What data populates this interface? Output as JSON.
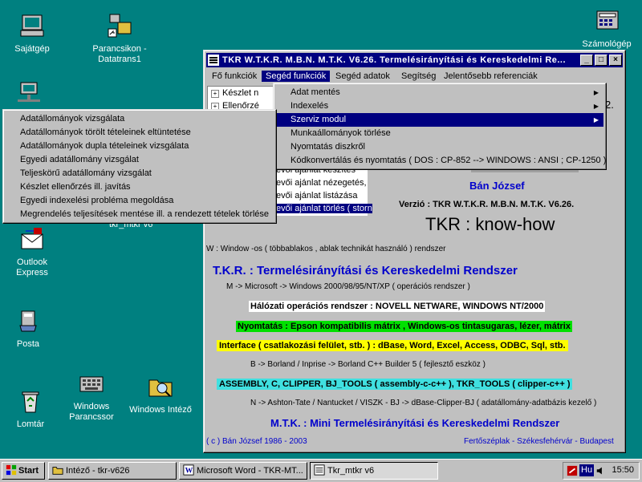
{
  "desktop": {
    "icons": [
      {
        "label": "Sajátgép",
        "name": "my-computer-icon"
      },
      {
        "label": "Parancsikon - Datatrans1",
        "name": "datatrans-shortcut-icon"
      },
      {
        "label": "Számológép",
        "name": "calculator-icon"
      },
      {
        "label": "Outlook Express",
        "name": "outlook-express-icon"
      },
      {
        "label": "Posta",
        "name": "posta-icon"
      },
      {
        "label": "Lomtár",
        "name": "recycle-bin-icon"
      },
      {
        "label": "Windows Parancssor",
        "name": "command-prompt-icon"
      },
      {
        "label": "Windows Intéző",
        "name": "windows-explorer-icon"
      }
    ],
    "partial_label": "tkr_mtkr v6"
  },
  "window": {
    "title": "TKR W.T.K.R. M.B.N. M.T.K. V6.26. Termelésirányítási és Kereskedelmi Re...",
    "minimize": "_",
    "maximize": "□",
    "close": "×",
    "menubar": [
      "Fő funkciók",
      "Segéd funkciók",
      "Segéd adatok",
      "Segítség",
      "Jelentősebb referenciák"
    ],
    "tree_rows": [
      "Készlet n",
      "Ellenőrzé",
      "evői ajánlat készítés",
      "evői ajánlat nézegetés,",
      "evői ajánlat listázása",
      "evői ajánlat törlés ( storn"
    ],
    "right_fragment": "2.",
    "author": "Bán József",
    "version": "Verzió : TKR W.T.K.R. M.B.N. M.T.K. V6.26.",
    "knowhow": "TKR :  know-how",
    "w_line": "W : Window -os ( többablakos , ablak technikát használó ) rendszer",
    "tkr_heading": "T.K.R. : Termelésirányítási és Kereskedelmi Rendszer",
    "m_line": "M -> Microsoft -> Windows 2000/98/95/NT/XP      ( operációs rendszer )",
    "network": "Hálózati operációs rendszer : NOVELL NETWARE, WINDOWS NT/2000",
    "printing": "Nyomtatás : Epson kompatibilis mátrix ,  Windows-os tintasugaras, lézer, mátrix",
    "interface": "Interface ( csatlakozási felület, stb. )  :  dBase, Word, Excel, Access, ODBC, Sql, stb.",
    "b_line": "B -> Borland / Inprise -> Borland C++ Builder 5      ( fejlesztő eszköz )",
    "assembly": "ASSEMBLY, C, CLIPPER, BJ_TOOLS ( assembly-c-c++ ), TKR_TOOLS ( clipper-c++ )",
    "n_line": "N -> Ashton-Tate / Nantucket / VISZK - BJ -> dBase-Clipper-BJ   ( adatállomány-adatbázis kezelő )",
    "mtk_heading": "M.T.K. : Mini Termelésirányítási és Kereskedelmi Rendszer",
    "copyright": "( c ) Bán József 1986 - 2003",
    "location": "Fertőszéplak - Székesfehérvár - Budapest"
  },
  "submenu": {
    "items": [
      {
        "label": "Adat mentés",
        "arrow": true
      },
      {
        "label": "Indexelés",
        "arrow": true
      },
      {
        "label": "Szerviz modul",
        "arrow": true
      },
      {
        "label": "Munkaállományok törlése",
        "arrow": false
      },
      {
        "label": "Nyomtatás diszkről",
        "arrow": false
      },
      {
        "label": "Kódkonvertálás és nyomtatás  ( DOS : CP-852 --> WINDOWS : ANSI ; CP-1250 )",
        "arrow": false
      }
    ],
    "arrow_glyph": "▶"
  },
  "service_menu": {
    "items": [
      "Adatállományok vizsgálata",
      "Adatállományok törölt tételeinek eltüntetése",
      "Adatállományok dupla tételeinek vizsgálata",
      "Egyedi adatállomány vizsgálat",
      "Teljeskörű adatállomány vizsgálat",
      "Készlet ellenőrzés ill. javítás",
      "Egyedi indexelési probléma megoldása",
      "Megrendelés teljesítések mentése ill. a rendezett tételek törlése"
    ]
  },
  "taskbar": {
    "start": "Start",
    "buttons": [
      "Intéző - tkr-v626",
      "Microsoft Word - TKR-MT...",
      "Tkr_mtkr v6"
    ],
    "lang": "Hu",
    "time": "15:50"
  },
  "colors": {
    "desktop": "#008080",
    "titlebar": "#000080",
    "blue_text": "#0000cc",
    "green_band": "#00e000",
    "yellow_band": "#ffff00",
    "cyan_band": "#40e0e0",
    "white_band": "#ffffff"
  }
}
